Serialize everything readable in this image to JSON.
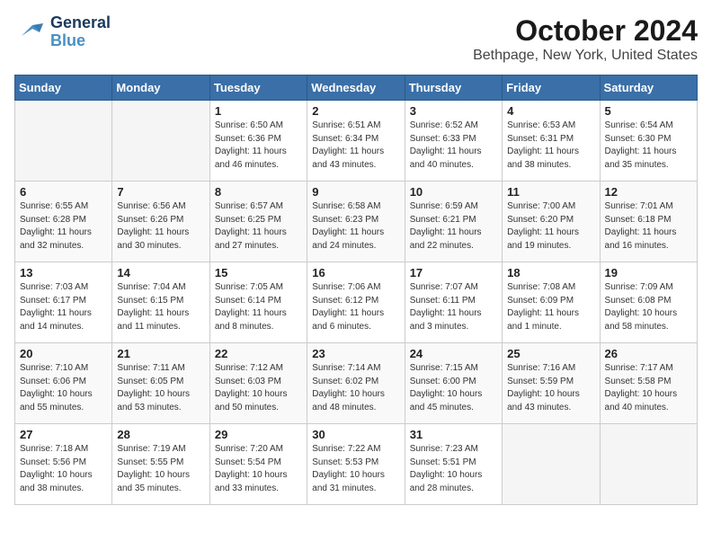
{
  "logo": {
    "line1": "General",
    "line2": "Blue"
  },
  "title": "October 2024",
  "location": "Bethpage, New York, United States",
  "weekdays": [
    "Sunday",
    "Monday",
    "Tuesday",
    "Wednesday",
    "Thursday",
    "Friday",
    "Saturday"
  ],
  "weeks": [
    [
      {
        "day": "",
        "info": ""
      },
      {
        "day": "",
        "info": ""
      },
      {
        "day": "1",
        "info": "Sunrise: 6:50 AM\nSunset: 6:36 PM\nDaylight: 11 hours\nand 46 minutes."
      },
      {
        "day": "2",
        "info": "Sunrise: 6:51 AM\nSunset: 6:34 PM\nDaylight: 11 hours\nand 43 minutes."
      },
      {
        "day": "3",
        "info": "Sunrise: 6:52 AM\nSunset: 6:33 PM\nDaylight: 11 hours\nand 40 minutes."
      },
      {
        "day": "4",
        "info": "Sunrise: 6:53 AM\nSunset: 6:31 PM\nDaylight: 11 hours\nand 38 minutes."
      },
      {
        "day": "5",
        "info": "Sunrise: 6:54 AM\nSunset: 6:30 PM\nDaylight: 11 hours\nand 35 minutes."
      }
    ],
    [
      {
        "day": "6",
        "info": "Sunrise: 6:55 AM\nSunset: 6:28 PM\nDaylight: 11 hours\nand 32 minutes."
      },
      {
        "day": "7",
        "info": "Sunrise: 6:56 AM\nSunset: 6:26 PM\nDaylight: 11 hours\nand 30 minutes."
      },
      {
        "day": "8",
        "info": "Sunrise: 6:57 AM\nSunset: 6:25 PM\nDaylight: 11 hours\nand 27 minutes."
      },
      {
        "day": "9",
        "info": "Sunrise: 6:58 AM\nSunset: 6:23 PM\nDaylight: 11 hours\nand 24 minutes."
      },
      {
        "day": "10",
        "info": "Sunrise: 6:59 AM\nSunset: 6:21 PM\nDaylight: 11 hours\nand 22 minutes."
      },
      {
        "day": "11",
        "info": "Sunrise: 7:00 AM\nSunset: 6:20 PM\nDaylight: 11 hours\nand 19 minutes."
      },
      {
        "day": "12",
        "info": "Sunrise: 7:01 AM\nSunset: 6:18 PM\nDaylight: 11 hours\nand 16 minutes."
      }
    ],
    [
      {
        "day": "13",
        "info": "Sunrise: 7:03 AM\nSunset: 6:17 PM\nDaylight: 11 hours\nand 14 minutes."
      },
      {
        "day": "14",
        "info": "Sunrise: 7:04 AM\nSunset: 6:15 PM\nDaylight: 11 hours\nand 11 minutes."
      },
      {
        "day": "15",
        "info": "Sunrise: 7:05 AM\nSunset: 6:14 PM\nDaylight: 11 hours\nand 8 minutes."
      },
      {
        "day": "16",
        "info": "Sunrise: 7:06 AM\nSunset: 6:12 PM\nDaylight: 11 hours\nand 6 minutes."
      },
      {
        "day": "17",
        "info": "Sunrise: 7:07 AM\nSunset: 6:11 PM\nDaylight: 11 hours\nand 3 minutes."
      },
      {
        "day": "18",
        "info": "Sunrise: 7:08 AM\nSunset: 6:09 PM\nDaylight: 11 hours\nand 1 minute."
      },
      {
        "day": "19",
        "info": "Sunrise: 7:09 AM\nSunset: 6:08 PM\nDaylight: 10 hours\nand 58 minutes."
      }
    ],
    [
      {
        "day": "20",
        "info": "Sunrise: 7:10 AM\nSunset: 6:06 PM\nDaylight: 10 hours\nand 55 minutes."
      },
      {
        "day": "21",
        "info": "Sunrise: 7:11 AM\nSunset: 6:05 PM\nDaylight: 10 hours\nand 53 minutes."
      },
      {
        "day": "22",
        "info": "Sunrise: 7:12 AM\nSunset: 6:03 PM\nDaylight: 10 hours\nand 50 minutes."
      },
      {
        "day": "23",
        "info": "Sunrise: 7:14 AM\nSunset: 6:02 PM\nDaylight: 10 hours\nand 48 minutes."
      },
      {
        "day": "24",
        "info": "Sunrise: 7:15 AM\nSunset: 6:00 PM\nDaylight: 10 hours\nand 45 minutes."
      },
      {
        "day": "25",
        "info": "Sunrise: 7:16 AM\nSunset: 5:59 PM\nDaylight: 10 hours\nand 43 minutes."
      },
      {
        "day": "26",
        "info": "Sunrise: 7:17 AM\nSunset: 5:58 PM\nDaylight: 10 hours\nand 40 minutes."
      }
    ],
    [
      {
        "day": "27",
        "info": "Sunrise: 7:18 AM\nSunset: 5:56 PM\nDaylight: 10 hours\nand 38 minutes."
      },
      {
        "day": "28",
        "info": "Sunrise: 7:19 AM\nSunset: 5:55 PM\nDaylight: 10 hours\nand 35 minutes."
      },
      {
        "day": "29",
        "info": "Sunrise: 7:20 AM\nSunset: 5:54 PM\nDaylight: 10 hours\nand 33 minutes."
      },
      {
        "day": "30",
        "info": "Sunrise: 7:22 AM\nSunset: 5:53 PM\nDaylight: 10 hours\nand 31 minutes."
      },
      {
        "day": "31",
        "info": "Sunrise: 7:23 AM\nSunset: 5:51 PM\nDaylight: 10 hours\nand 28 minutes."
      },
      {
        "day": "",
        "info": ""
      },
      {
        "day": "",
        "info": ""
      }
    ]
  ]
}
